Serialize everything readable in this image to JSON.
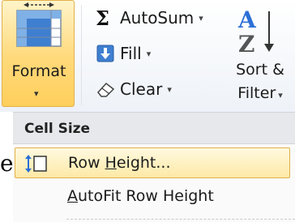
{
  "ribbon": {
    "format": {
      "label": "Format",
      "icon": "format-cells-icon"
    },
    "autosum": {
      "label": "AutoSum",
      "icon": "sigma-icon",
      "symbol": "Σ"
    },
    "fill": {
      "label": "Fill",
      "icon": "fill-down-icon"
    },
    "clear": {
      "label": "Clear",
      "icon": "eraser-icon"
    },
    "sort": {
      "label_line1": "Sort &",
      "label_line2": "Filter",
      "icon": "sort-az-icon",
      "letter_a": "A",
      "letter_z": "Z"
    }
  },
  "menu": {
    "section_header": "Cell Size",
    "items": [
      {
        "pre": "Row ",
        "mnemonic": "H",
        "post": "eight...",
        "icon": "row-height-icon",
        "highlighted": true
      },
      {
        "pre": "",
        "mnemonic": "A",
        "post": "utoFit Row Height",
        "icon": "",
        "highlighted": false
      }
    ]
  },
  "background_text": {
    "fragment": "e"
  },
  "colors": {
    "highlight_border": "#e2b04a",
    "highlight_fill": "#fde9a6",
    "header_bg": "#e6e8eb",
    "accent_blue": "#2b6fd6"
  }
}
